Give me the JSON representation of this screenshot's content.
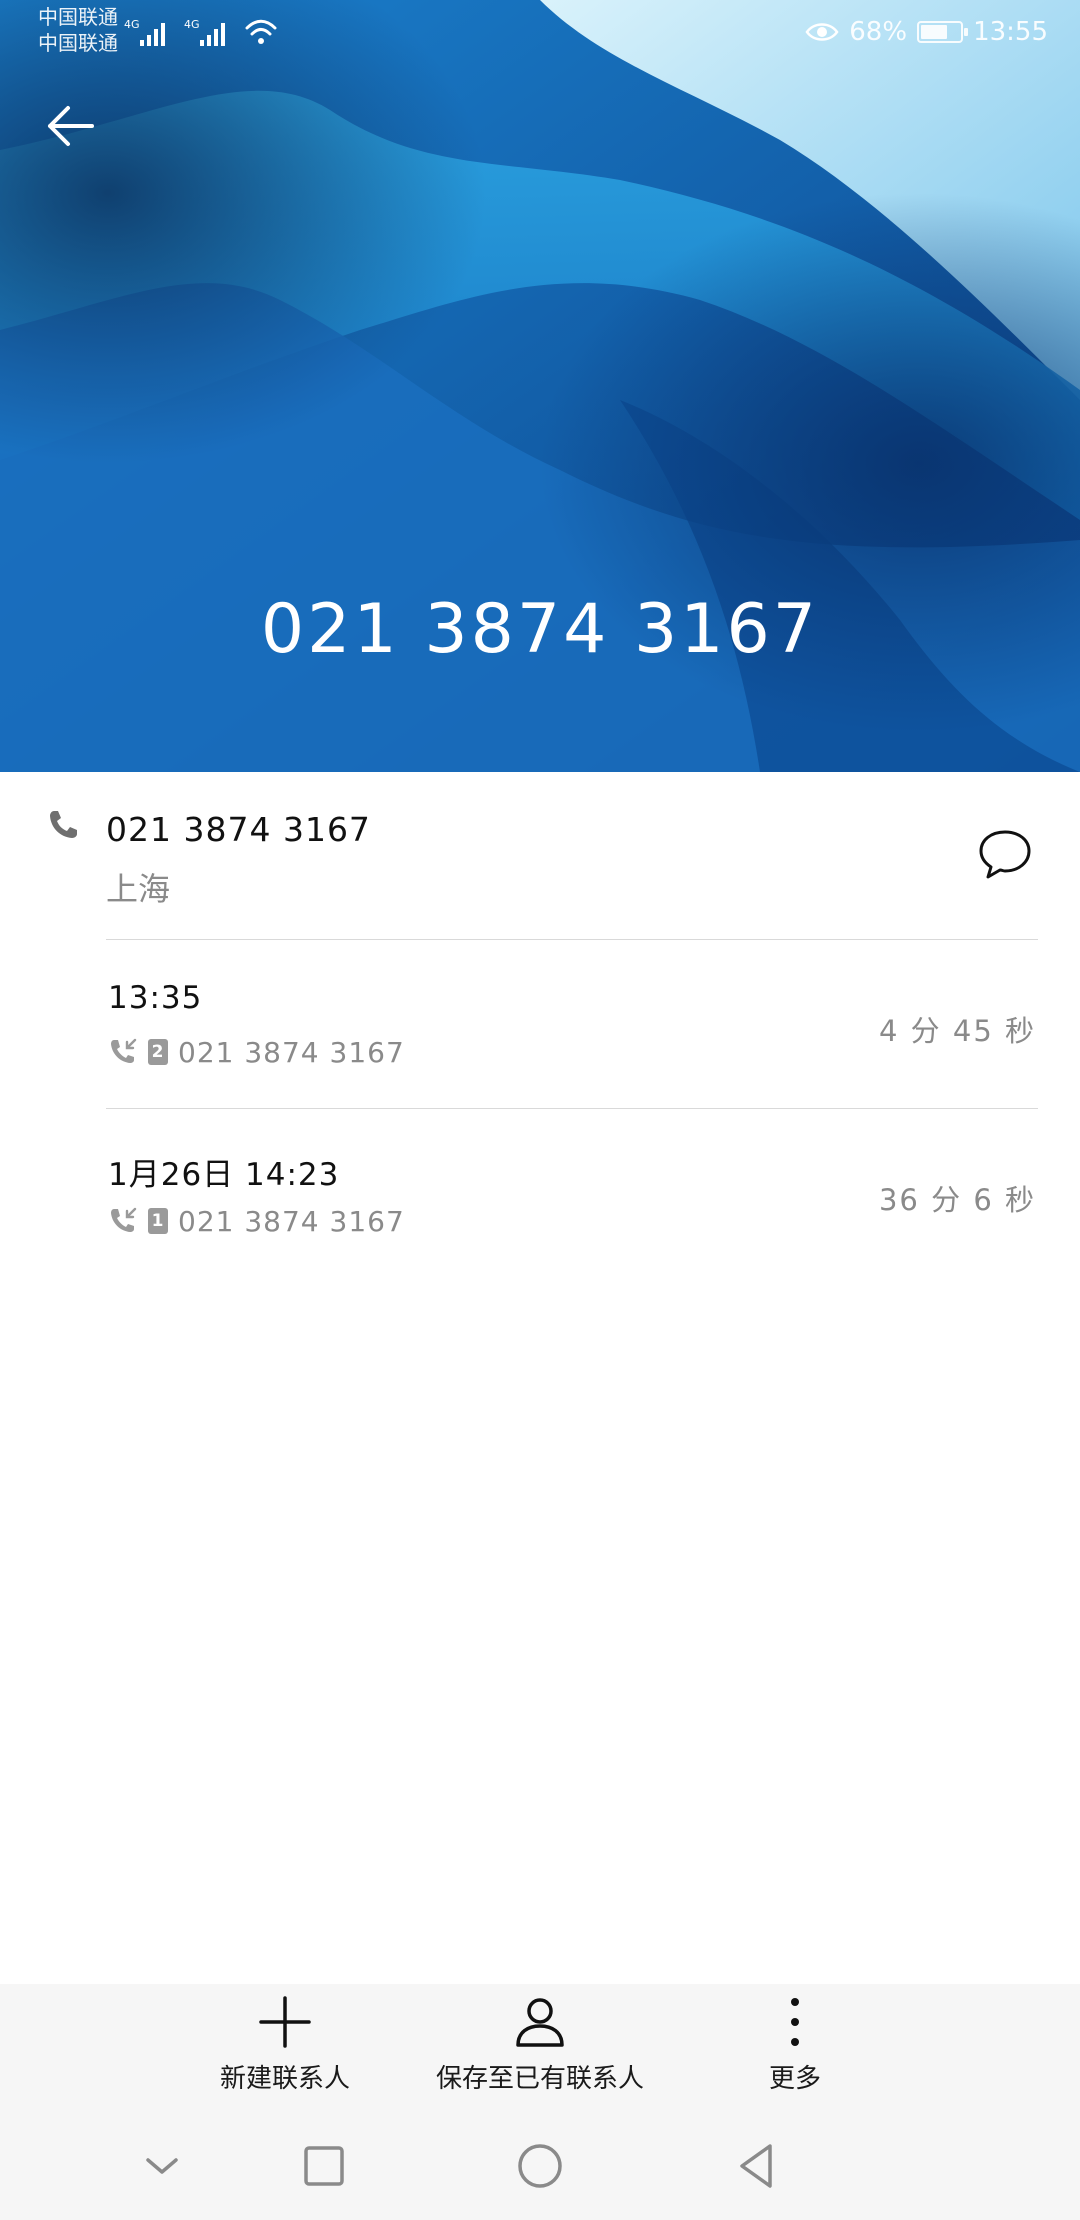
{
  "status_bar": {
    "carrier1": "中国联通",
    "carrier2": "中国联通",
    "net1": "4G",
    "net2": "4G",
    "battery": "68%",
    "battery_level": 0.68,
    "time": "13:55"
  },
  "header": {
    "phone_number": "021 3874 3167"
  },
  "contact": {
    "phone_number": "021 3874 3167",
    "location": "上海"
  },
  "calls": [
    {
      "time": "13:35",
      "sim": "2",
      "number": "021 3874 3167",
      "duration": "4 分 45 秒"
    },
    {
      "time": "1月26日 14:23",
      "sim": "1",
      "number": "021 3874 3167",
      "duration": "36 分 6 秒"
    }
  ],
  "actions": {
    "new_contact": "新建联系人",
    "save_existing": "保存至已有联系人",
    "more": "更多"
  },
  "icons": {
    "back": "back-arrow-icon",
    "phone": "phone-icon",
    "message": "message-bubble-icon",
    "incoming_call": "incoming-call-icon",
    "add": "plus-icon",
    "person": "person-icon",
    "more": "more-vertical-icon"
  },
  "colors": {
    "hero_blue": "#1f86d1",
    "hero_dark": "#0d3f80",
    "secondary_text": "#8a8a8a"
  }
}
